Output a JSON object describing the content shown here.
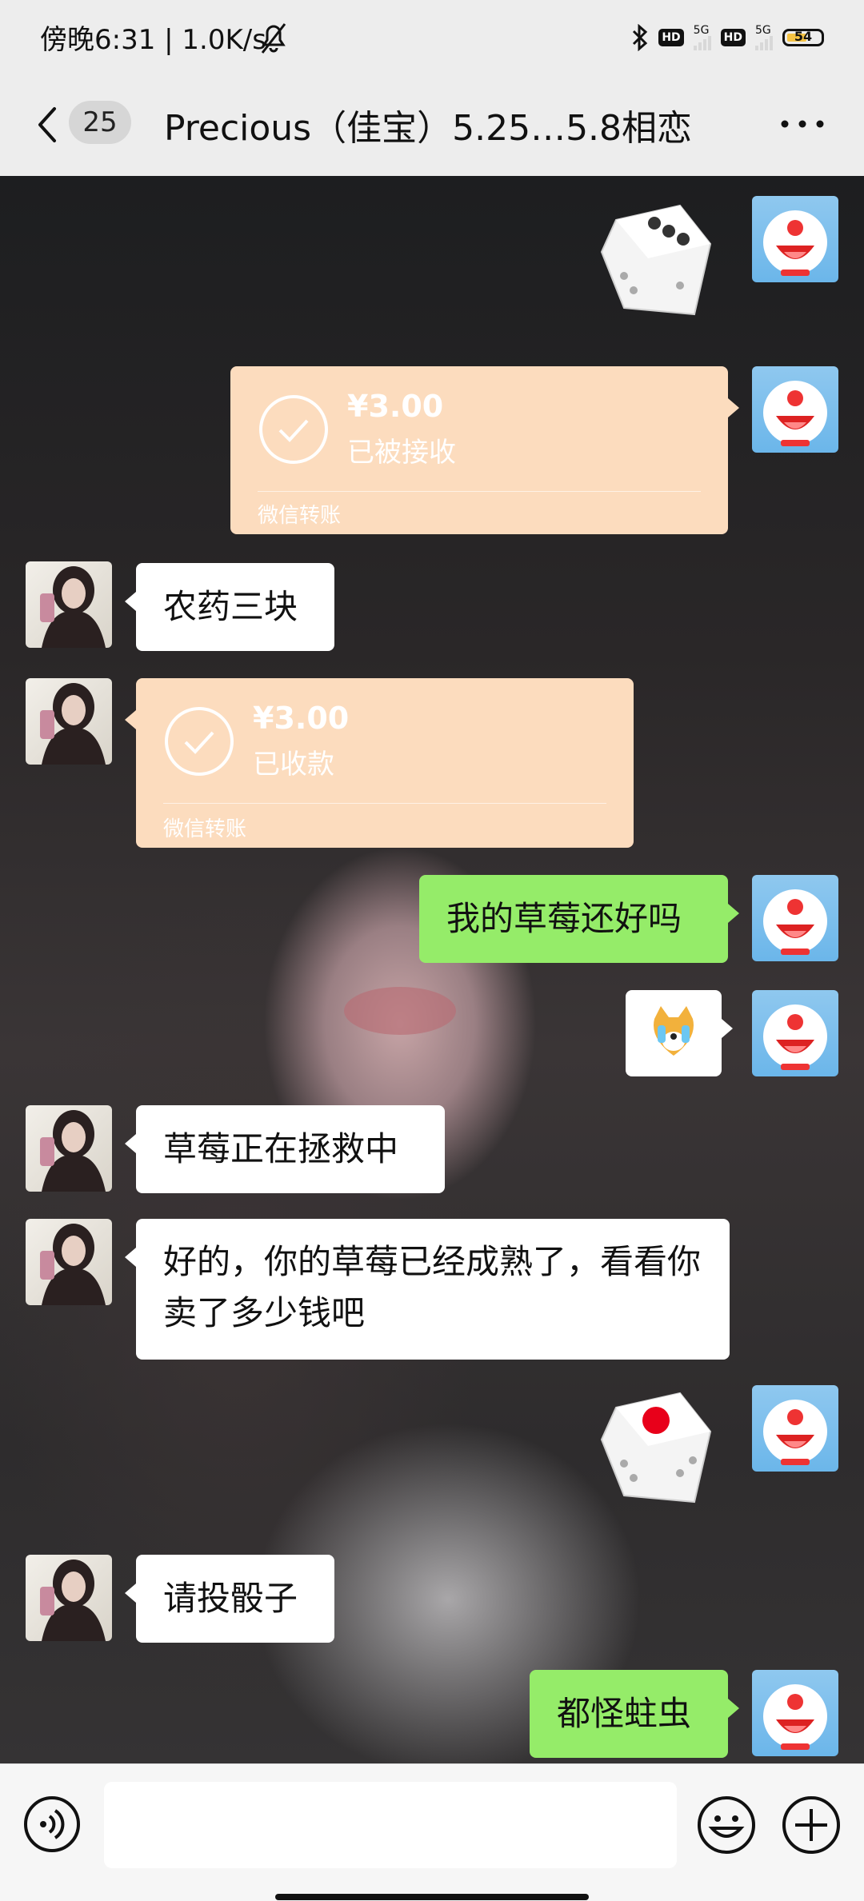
{
  "status_bar": {
    "time_speed": "傍晚6:31 | 1.0K/s",
    "hd1": "HD",
    "net1": "5G",
    "hd2": "HD",
    "net2": "5G",
    "battery": "54"
  },
  "header": {
    "unread_count": "25",
    "title": "Precious（佳宝）5.25…5.8相恋"
  },
  "messages": {
    "transfer1": {
      "amount": "¥3.00",
      "status": "已被接收",
      "source": "微信转账"
    },
    "msg_pesticide": "农药三块",
    "transfer2": {
      "amount": "¥3.00",
      "status": "已收款",
      "source": "微信转账"
    },
    "msg_strawberry_ok": "我的草莓还好吗",
    "msg_rescuing": "草莓正在拯救中",
    "msg_ripe": "好的，你的草莓已经成熟了，看看你卖了多少钱吧",
    "msg_roll_dice": "请投骰子",
    "msg_bugs": "都怪蛀虫"
  },
  "dice_rolls": {
    "first": 3,
    "second": 1
  },
  "input": {
    "placeholder": ""
  },
  "colors": {
    "green_bubble": "#95ec69",
    "transfer": "#fcdcbe",
    "bg": "#ededed"
  }
}
